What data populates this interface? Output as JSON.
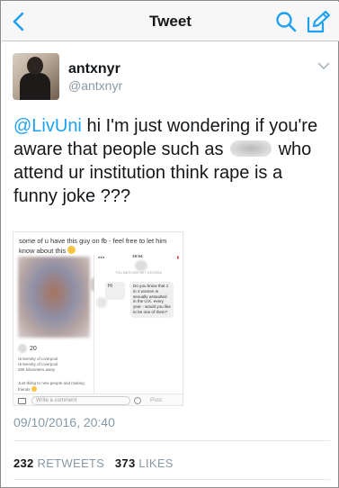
{
  "colors": {
    "accent": "#1da1f2",
    "secondary_text": "#8899a6"
  },
  "nav": {
    "title": "Tweet",
    "back_icon": "chevron-left-icon",
    "search_icon": "search-icon",
    "compose_icon": "compose-icon"
  },
  "tweet": {
    "display_name": "antxnyr",
    "handle": "@antxnyr",
    "mention": "@LivUni",
    "text_part1": " hi I'm just wondering if you're aware that people such as ",
    "text_part2": " who attend ur institution think rape is a funny joke ???",
    "timestamp": "09/10/2016, 20:40",
    "retweets_count": "232",
    "retweets_label": "RETWEETS",
    "likes_count": "373",
    "likes_label": "LIKES"
  },
  "media": {
    "caption": "some of u have this guy on fb - feel free to let him know about this",
    "status_time": "19:54",
    "age": "20",
    "info": "University of Liverpool\nUniversity of Liverpool\n285 kilometers away",
    "bio": "Just tkiing to new people and making friends",
    "comment_placeholder": "Write a comment",
    "post_label": "Post",
    "chat_header": "YOU MATCHED WIT          3/10/2016",
    "bubble_left": "Hi",
    "bubble_right": "Do you know that 1 in 4 women is sexually assaulted in the U.K. every year - would you like to be one of them?"
  }
}
